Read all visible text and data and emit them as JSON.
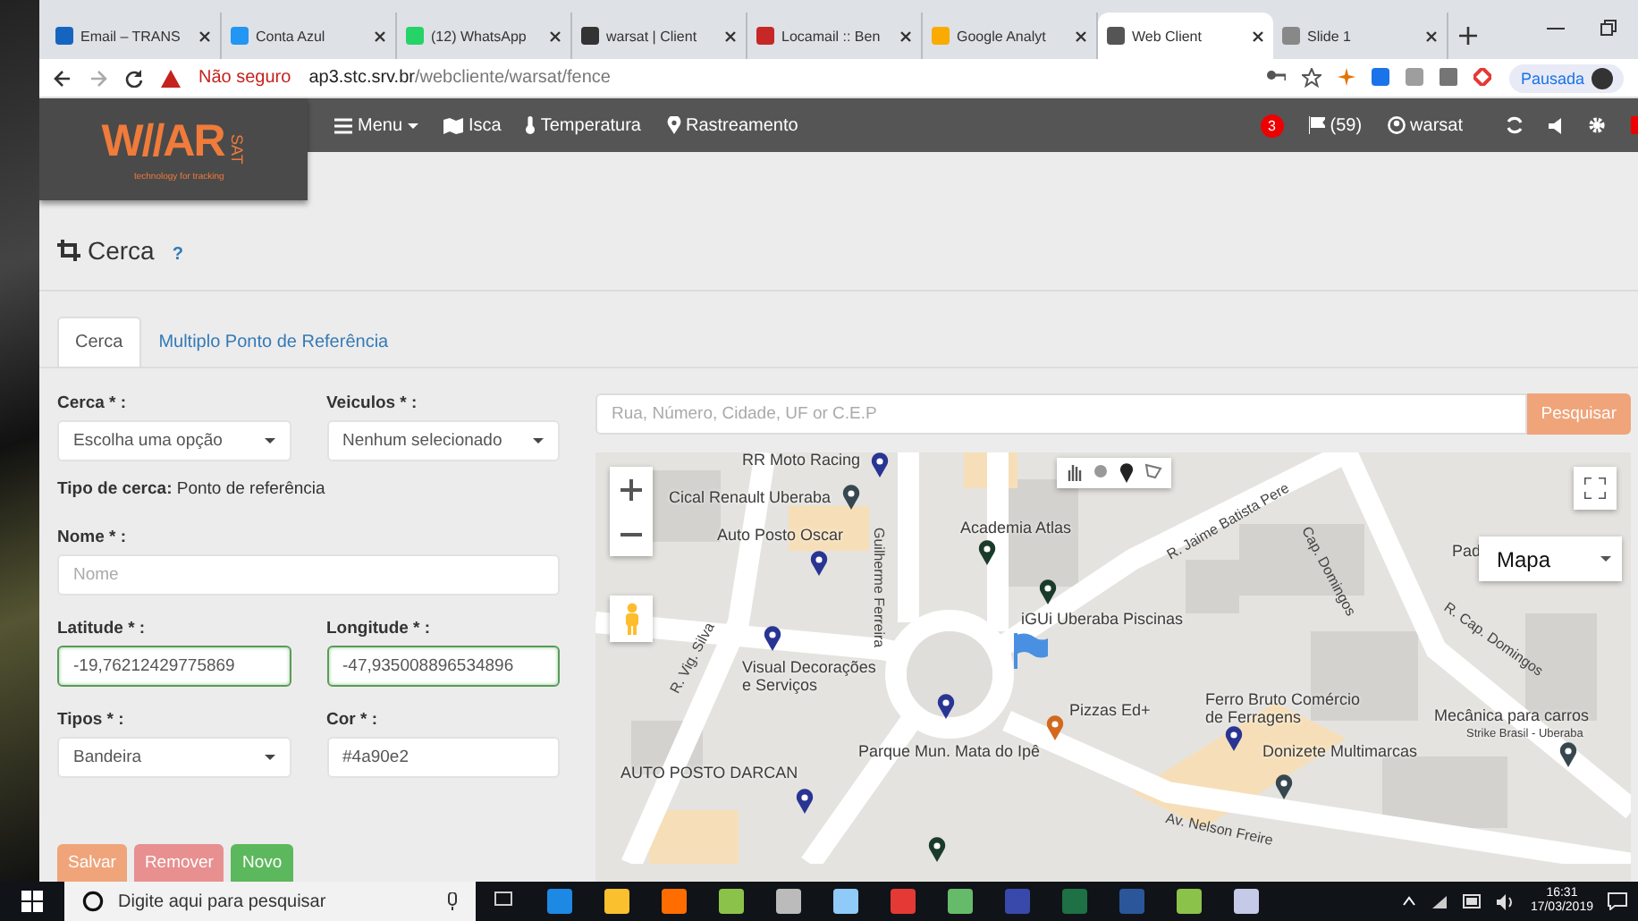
{
  "browser": {
    "tabs": [
      {
        "title": "Email – TRANS",
        "selected": false
      },
      {
        "title": "Conta Azul",
        "selected": false
      },
      {
        "title": "(12) WhatsApp",
        "selected": false
      },
      {
        "title": "warsat | Client",
        "selected": false
      },
      {
        "title": "Locamail :: Ben",
        "selected": false
      },
      {
        "title": "Google Analyt",
        "selected": false
      },
      {
        "title": "Web Client",
        "selected": true
      },
      {
        "title": "Slide 1",
        "selected": false
      }
    ],
    "security": "Não seguro",
    "url_host": "ap3.stc.srv.br",
    "url_path": "/webcliente/warsat/fence",
    "profile": "Pausada"
  },
  "app": {
    "logo": {
      "mark": "W//AR",
      "side": "SAT",
      "tagline": "technology for tracking"
    },
    "nav": [
      {
        "label": "Menu",
        "kind": "menu"
      },
      {
        "label": "Isca",
        "kind": "map"
      },
      {
        "label": "Temperatura",
        "kind": "thermometer"
      },
      {
        "label": "Rastreamento",
        "kind": "pin"
      }
    ],
    "alerts": "3",
    "flags": "(59)",
    "user": "warsat"
  },
  "page": {
    "title": "Cerca",
    "help": "?",
    "tabs": [
      {
        "label": "Cerca",
        "selected": true
      },
      {
        "label": "Multiplo Ponto de Referência",
        "selected": false
      }
    ],
    "form": {
      "rows": [
        {
          "fields": [
            {
              "label": "Cerca * :",
              "kind": "select",
              "value": "Escolha uma opção",
              "valid": false
            },
            {
              "label": "Veiculos * :",
              "kind": "select",
              "value": "Nenhum selecionado",
              "valid": false
            }
          ]
        },
        {
          "info_label": "Tipo de cerca:",
          "info_value": "Ponto de referência"
        },
        {
          "fields": [
            {
              "label": "Nome * :",
              "kind": "input",
              "placeholder": "Nome",
              "valid": false
            }
          ]
        },
        {
          "fields": [
            {
              "label": "Latitude * :",
              "kind": "input",
              "value": "-19,76212429775869",
              "valid": true
            },
            {
              "label": "Longitude * :",
              "kind": "input",
              "value": "-47,935008896534896",
              "valid": true
            }
          ]
        },
        {
          "fields": [
            {
              "label": "Tipos * :",
              "kind": "select",
              "value": "Bandeira",
              "valid": false
            },
            {
              "label": "Cor * :",
              "kind": "input",
              "value": "#4a90e2",
              "valid": false
            }
          ]
        }
      ],
      "buttons": [
        {
          "label": "Salvar",
          "kind": "save"
        },
        {
          "label": "Remover",
          "kind": "remove"
        },
        {
          "label": "Novo",
          "kind": "new"
        }
      ]
    },
    "map": {
      "search_placeholder": "Rua, Número, Cidade, UF or C.E.P",
      "search_button": "Pesquisar",
      "map_type": "Mapa",
      "places": [
        "RR Moto Racing",
        "Cical Renault Uberaba",
        "Auto Posto Oscar",
        "Academia Atlas",
        "iGUi Uberaba Piscinas",
        "Visual Decorações\ne Serviços",
        "Pizzas Ed+",
        "Ferro Bruto Comércio\nde Ferragens",
        "Mecânica para carros",
        "Strike Brasil - Uberaba",
        "Parque Mun. Mata do Ipê",
        "Donizete Multimarcas",
        "AUTO POSTO DARCAN",
        "Pad"
      ],
      "streets": [
        "Guilherme Ferreira",
        "R. Jaime Batista Pere",
        "Cap. Domingos",
        "R. Cap. Domingos",
        "R. Vig. Silva",
        "Av. Nelson Freire"
      ]
    }
  },
  "taskbar": {
    "search_placeholder": "Digite aqui para pesquisar",
    "time": "16:31",
    "date": "17/03/2019"
  }
}
